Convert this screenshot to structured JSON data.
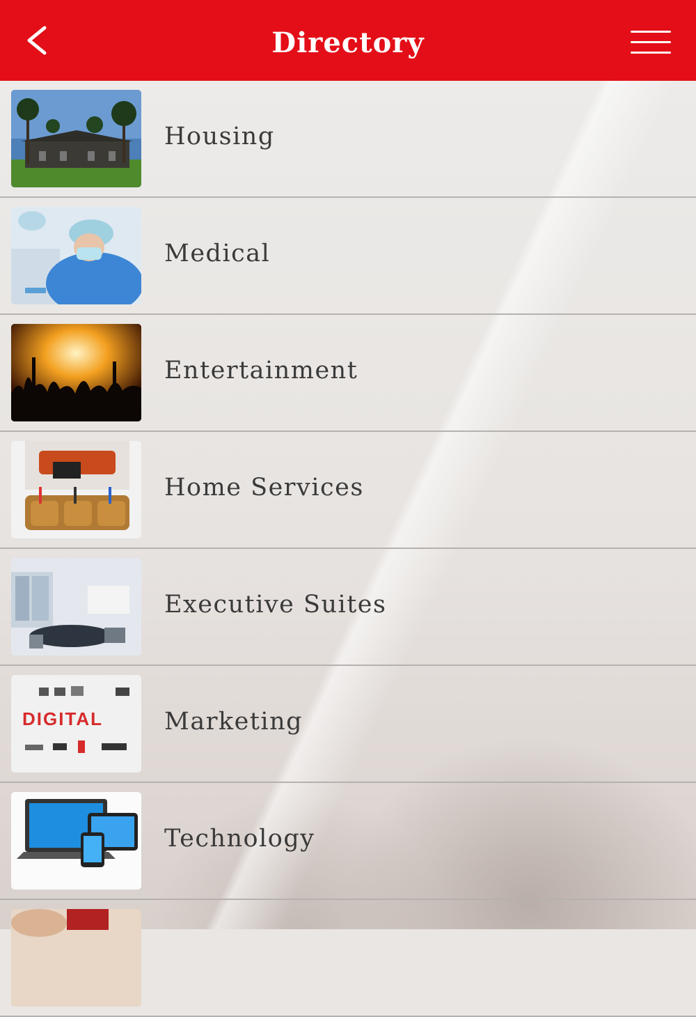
{
  "header": {
    "title": "Directory",
    "back_icon": "chevron-left-icon",
    "menu_icon": "hamburger-menu-icon",
    "background_color": "#e30e17"
  },
  "list": {
    "items": [
      {
        "label": "Housing",
        "image": "housing-photo"
      },
      {
        "label": "Medical",
        "image": "medical-photo"
      },
      {
        "label": "Entertainment",
        "image": "entertainment-photo"
      },
      {
        "label": "Home Services",
        "image": "home-services-photo"
      },
      {
        "label": "Executive Suites",
        "image": "executive-suites-photo"
      },
      {
        "label": "Marketing",
        "image": "marketing-photo",
        "image_text": "DIGITAL"
      },
      {
        "label": "Technology",
        "image": "technology-photo"
      },
      {
        "label": "",
        "image": "partial-photo"
      }
    ]
  }
}
